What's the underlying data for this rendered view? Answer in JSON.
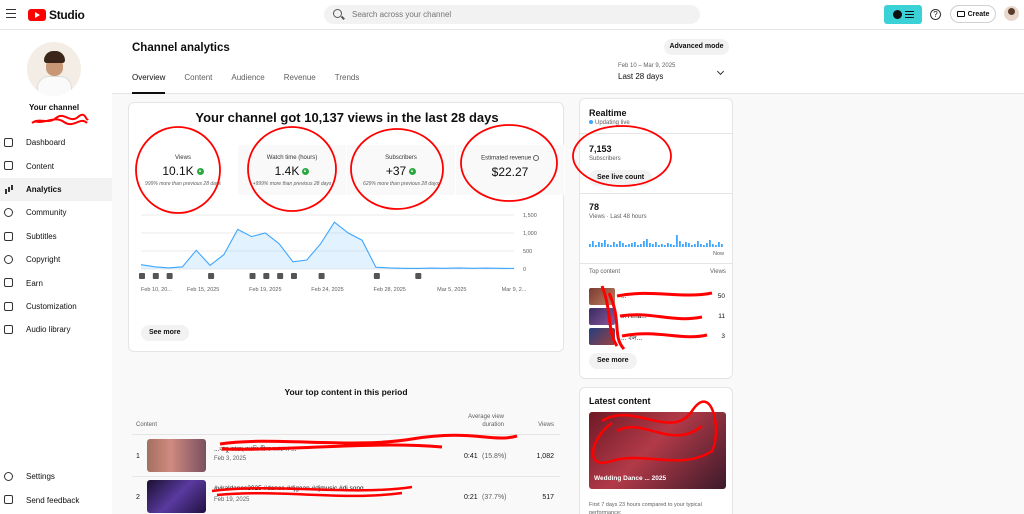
{
  "app": {
    "brand": "Studio",
    "search_placeholder": "Search across your channel",
    "create_label": "Create",
    "help_label": "?"
  },
  "sidebar": {
    "channel_label": "Your channel",
    "items": [
      {
        "label": "Dashboard",
        "icon": "dashboard-icon"
      },
      {
        "label": "Content",
        "icon": "content-icon"
      },
      {
        "label": "Analytics",
        "icon": "analytics-icon",
        "active": true
      },
      {
        "label": "Community",
        "icon": "community-icon"
      },
      {
        "label": "Subtitles",
        "icon": "subtitles-icon"
      },
      {
        "label": "Copyright",
        "icon": "copyright-icon"
      },
      {
        "label": "Earn",
        "icon": "earn-icon"
      },
      {
        "label": "Customization",
        "icon": "customization-icon"
      },
      {
        "label": "Audio library",
        "icon": "audio-library-icon"
      }
    ],
    "bottom": [
      {
        "label": "Settings",
        "icon": "settings-icon"
      },
      {
        "label": "Send feedback",
        "icon": "feedback-icon"
      }
    ]
  },
  "page": {
    "title": "Channel analytics",
    "advanced_mode": "Advanced mode",
    "tabs": [
      "Overview",
      "Content",
      "Audience",
      "Revenue",
      "Trends"
    ],
    "date_range_small": "Feb 10 – Mar 9, 2025",
    "date_range": "Last 28 days"
  },
  "overview": {
    "headline": "Your channel got 10,137 views in the last 28 days",
    "metrics": [
      {
        "label": "Views",
        "value": "10.1K",
        "note": "999% more than previous 28 days"
      },
      {
        "label": "Watch time (hours)",
        "value": "1.4K",
        "note": "+999% more than previous 28 days"
      },
      {
        "label": "Subscribers",
        "value": "+37",
        "note": "629% more than previous 28 days"
      },
      {
        "label": "Estimated revenue",
        "value": "$22.27",
        "note": ""
      }
    ],
    "see_more": "See more"
  },
  "chart_data": {
    "type": "area",
    "x": [
      "Feb 10",
      "Feb 11",
      "Feb 12",
      "Feb 13",
      "Feb 14",
      "Feb 15",
      "Feb 16",
      "Feb 17",
      "Feb 18",
      "Feb 19",
      "Feb 20",
      "Feb 21",
      "Feb 22",
      "Feb 23",
      "Feb 24",
      "Feb 25",
      "Feb 26",
      "Feb 27",
      "Feb 28",
      "Mar 1",
      "Mar 2",
      "Mar 3",
      "Mar 4",
      "Mar 5",
      "Mar 6",
      "Mar 7",
      "Mar 8",
      "Mar 9"
    ],
    "series": [
      {
        "values": [
          120,
          60,
          30,
          60,
          520,
          100,
          400,
          1100,
          900,
          1000,
          700,
          200,
          250,
          700,
          1300,
          1000,
          800,
          50,
          30,
          20,
          15,
          25,
          20,
          30,
          20,
          25,
          20,
          15
        ]
      }
    ],
    "xtick_labels": [
      "Feb 10, 20...",
      "Feb 15, 2025",
      "Feb 19, 2025",
      "Feb 24, 2025",
      "Feb 28, 2025",
      "Mar 5, 2025",
      "Mar 9, 2..."
    ],
    "ytick_labels": [
      "1,500",
      "1,000",
      "500",
      "0"
    ],
    "ylim": [
      0,
      1500
    ],
    "grid": true,
    "color": "#3ea6ff"
  },
  "top_content": {
    "title": "Your top content in this period",
    "col_content": "Content",
    "col_avd": "Average view duration",
    "col_views": "Views",
    "rows": [
      {
        "idx": "1",
        "title": "...বাবু কাছে আমি নীল আলো ...",
        "date": "Feb 3, 2025",
        "avd": "0:41",
        "pct": "(15.8%)",
        "views": "1,082"
      },
      {
        "idx": "2",
        "title": "#viraldance2025 #dance #djgaan #djmusic #dj song",
        "date": "Feb 19, 2025",
        "avd": "0:21",
        "pct": "(37.7%)",
        "views": "517"
      }
    ]
  },
  "realtime": {
    "title": "Realtime",
    "live": "Updating live",
    "subscribers": "7,153",
    "subscribers_label": "Subscribers",
    "see_live": "See live count",
    "views": "78",
    "views_label": "Views · Last 48 hours",
    "now_label": "Now",
    "top_content_label": "Top content",
    "views_header": "Views",
    "items": [
      {
        "name": "...",
        "views": "50"
      },
      {
        "name": "... Ama...",
        "views": "11"
      },
      {
        "name": "... বল...",
        "views": "3"
      }
    ],
    "see_more": "See more"
  },
  "latest": {
    "title": "Latest content",
    "thumb_text": "Wedding Dance ... 2025",
    "note": "First 7 days 23 hours compared to your typical performance:"
  }
}
